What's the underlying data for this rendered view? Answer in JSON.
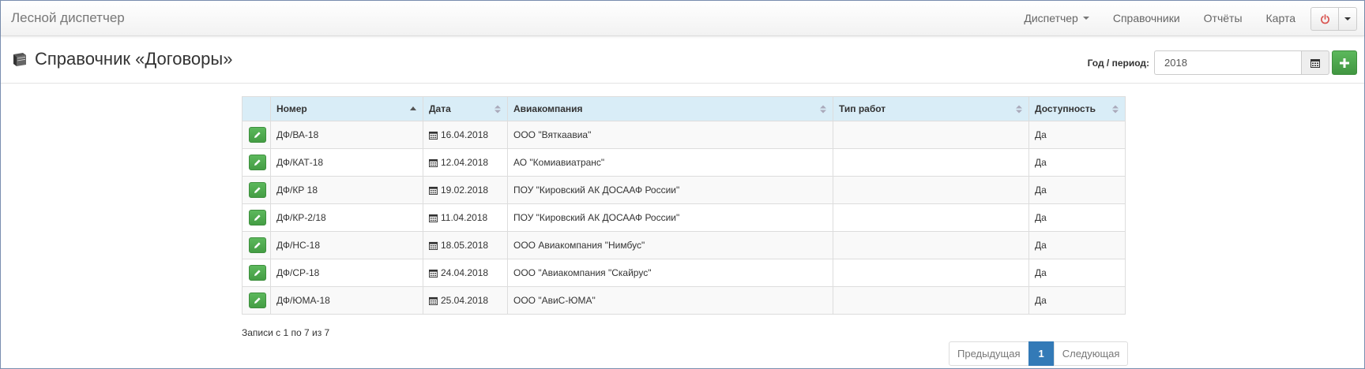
{
  "navbar": {
    "brand": "Лесной диспетчер",
    "links": [
      {
        "label": "Диспетчер",
        "dropdown": true
      },
      {
        "label": "Справочники",
        "dropdown": false
      },
      {
        "label": "Отчёты",
        "dropdown": false
      },
      {
        "label": "Карта",
        "dropdown": false
      }
    ],
    "power_icon": "power-icon"
  },
  "header": {
    "title": "Справочник «Договоры»",
    "title_icon": "book-icon",
    "period_label": "Год / период:",
    "period_value": "2018",
    "calendar_icon": "calendar-icon",
    "add_icon": "plus-icon"
  },
  "table": {
    "columns": [
      "",
      "Номер",
      "Дата",
      "Авиакомпания",
      "Тип работ",
      "Доступность"
    ],
    "sorted_column": "Номер",
    "rows": [
      {
        "number": "ДФ/ВА-18",
        "date": "16.04.2018",
        "airline": "ООО \"Вяткаавиа\"",
        "work_type": "",
        "availability": "Да"
      },
      {
        "number": "ДФ/КАТ-18",
        "date": "12.04.2018",
        "airline": "АО \"Комиавиатранс\"",
        "work_type": "",
        "availability": "Да"
      },
      {
        "number": "ДФ/КР 18",
        "date": "19.02.2018",
        "airline": "ПОУ \"Кировский АК ДОСААФ России\"",
        "work_type": "",
        "availability": "Да"
      },
      {
        "number": "ДФ/КР-2/18",
        "date": "11.04.2018",
        "airline": "ПОУ \"Кировский АК ДОСААФ России\"",
        "work_type": "",
        "availability": "Да"
      },
      {
        "number": "ДФ/НС-18",
        "date": "18.05.2018",
        "airline": "ООО Авиакомпания \"Нимбус\"",
        "work_type": "",
        "availability": "Да"
      },
      {
        "number": "ДФ/СР-18",
        "date": "24.04.2018",
        "airline": "ООО \"Авиакомпания \"Скайрус\"",
        "work_type": "",
        "availability": "Да"
      },
      {
        "number": "ДФ/ЮМА-18",
        "date": "25.04.2018",
        "airline": "ООО \"АвиС-ЮМА\"",
        "work_type": "",
        "availability": "Да"
      }
    ]
  },
  "footer": {
    "info": "Записи с 1 по 7 из 7",
    "prev": "Предыдущая",
    "page": "1",
    "next": "Следующая"
  },
  "colors": {
    "header_bg": "#d9edf7",
    "accent_green": "#5cb85c",
    "accent_blue": "#337ab7",
    "power_red": "#d9534f"
  }
}
